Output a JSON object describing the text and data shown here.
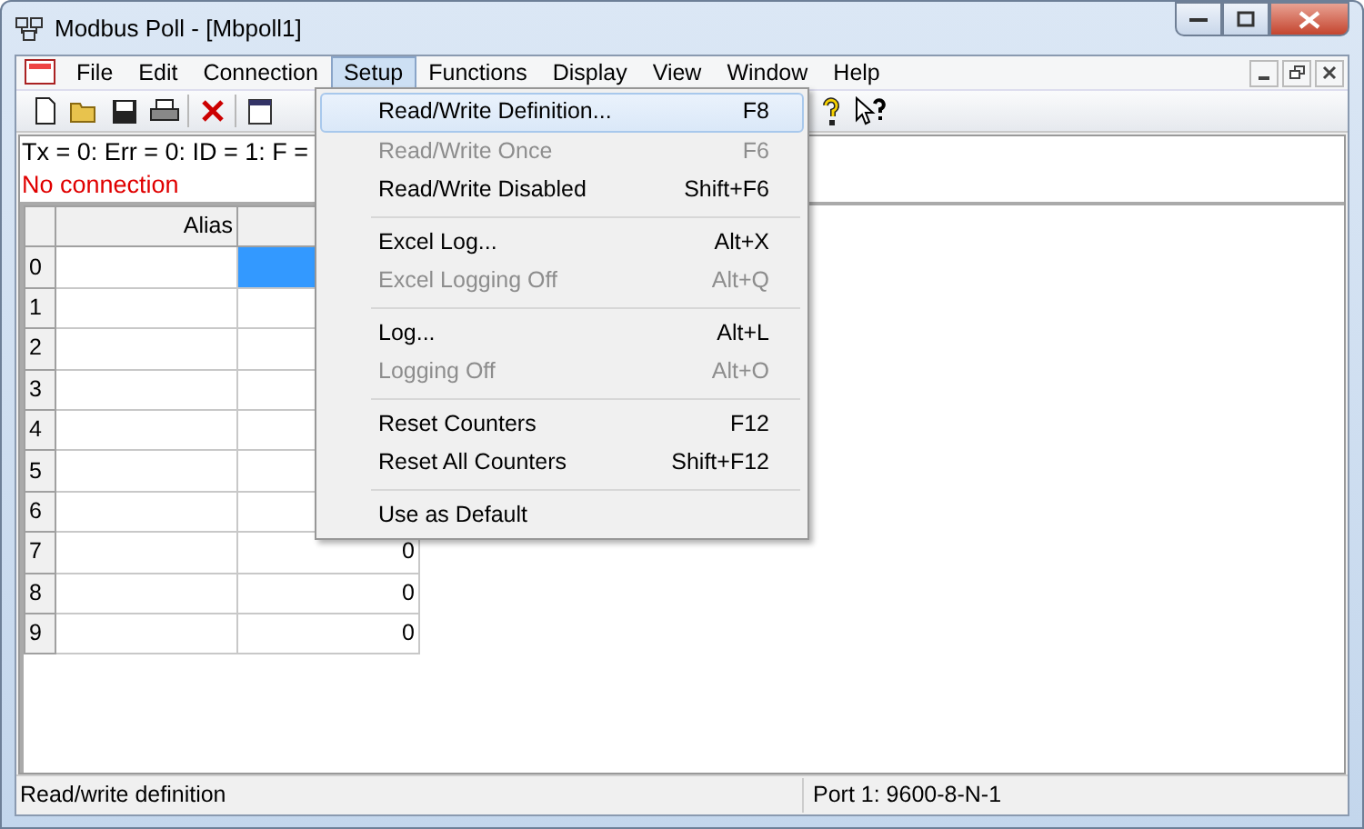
{
  "window": {
    "title": "Modbus Poll - [Mbpoll1]"
  },
  "menu": [
    {
      "label": "File",
      "selected": false
    },
    {
      "label": "Edit",
      "selected": false
    },
    {
      "label": "Connection",
      "selected": false
    },
    {
      "label": "Setup",
      "selected": true
    },
    {
      "label": "Functions",
      "selected": false
    },
    {
      "label": "Display",
      "selected": false
    },
    {
      "label": "View",
      "selected": false
    },
    {
      "label": "Window",
      "selected": false
    },
    {
      "label": "Help",
      "selected": false
    }
  ],
  "status_lines": [
    {
      "text": "Tx = 0: Err = 0: ID = 1: F =",
      "kind": "info"
    },
    {
      "text": "No connection",
      "kind": "error"
    }
  ],
  "grid": {
    "columns": [
      "Alias"
    ],
    "rows": [
      {
        "index": "0",
        "selected": true
      },
      {
        "index": "1",
        "selected": false
      },
      {
        "index": "2",
        "selected": false
      },
      {
        "index": "3",
        "selected": false
      },
      {
        "index": "4",
        "selected": false
      },
      {
        "index": "5",
        "selected": false
      },
      {
        "index": "6",
        "selected": false
      },
      {
        "index": "7",
        "value": "0",
        "selected": false
      },
      {
        "index": "8",
        "value": "0",
        "selected": false
      },
      {
        "index": "9",
        "value": "0",
        "selected": false
      }
    ]
  },
  "dropdown": {
    "groups": [
      [
        {
          "label": "Read/Write Definition...",
          "shortcut": "F8",
          "disabled": false,
          "selected": true
        },
        {
          "label": "Read/Write Once",
          "shortcut": "F6",
          "disabled": true,
          "selected": false
        },
        {
          "label": "Read/Write Disabled",
          "shortcut": "Shift+F6",
          "disabled": false,
          "selected": false
        }
      ],
      [
        {
          "label": "Excel Log...",
          "shortcut": "Alt+X",
          "disabled": false,
          "selected": false
        },
        {
          "label": "Excel Logging Off",
          "shortcut": "Alt+Q",
          "disabled": true,
          "selected": false
        }
      ],
      [
        {
          "label": "Log...",
          "shortcut": "Alt+L",
          "disabled": false,
          "selected": false
        },
        {
          "label": "Logging Off",
          "shortcut": "Alt+O",
          "disabled": true,
          "selected": false
        }
      ],
      [
        {
          "label": "Reset Counters",
          "shortcut": "F12",
          "disabled": false,
          "selected": false
        },
        {
          "label": "Reset All Counters",
          "shortcut": "Shift+F12",
          "disabled": false,
          "selected": false
        }
      ],
      [
        {
          "label": "Use as Default",
          "disabled": false,
          "selected": false
        }
      ]
    ]
  },
  "status_bar": {
    "message": "Read/write definition",
    "port": "Port 1: 9600-8-N-1"
  }
}
